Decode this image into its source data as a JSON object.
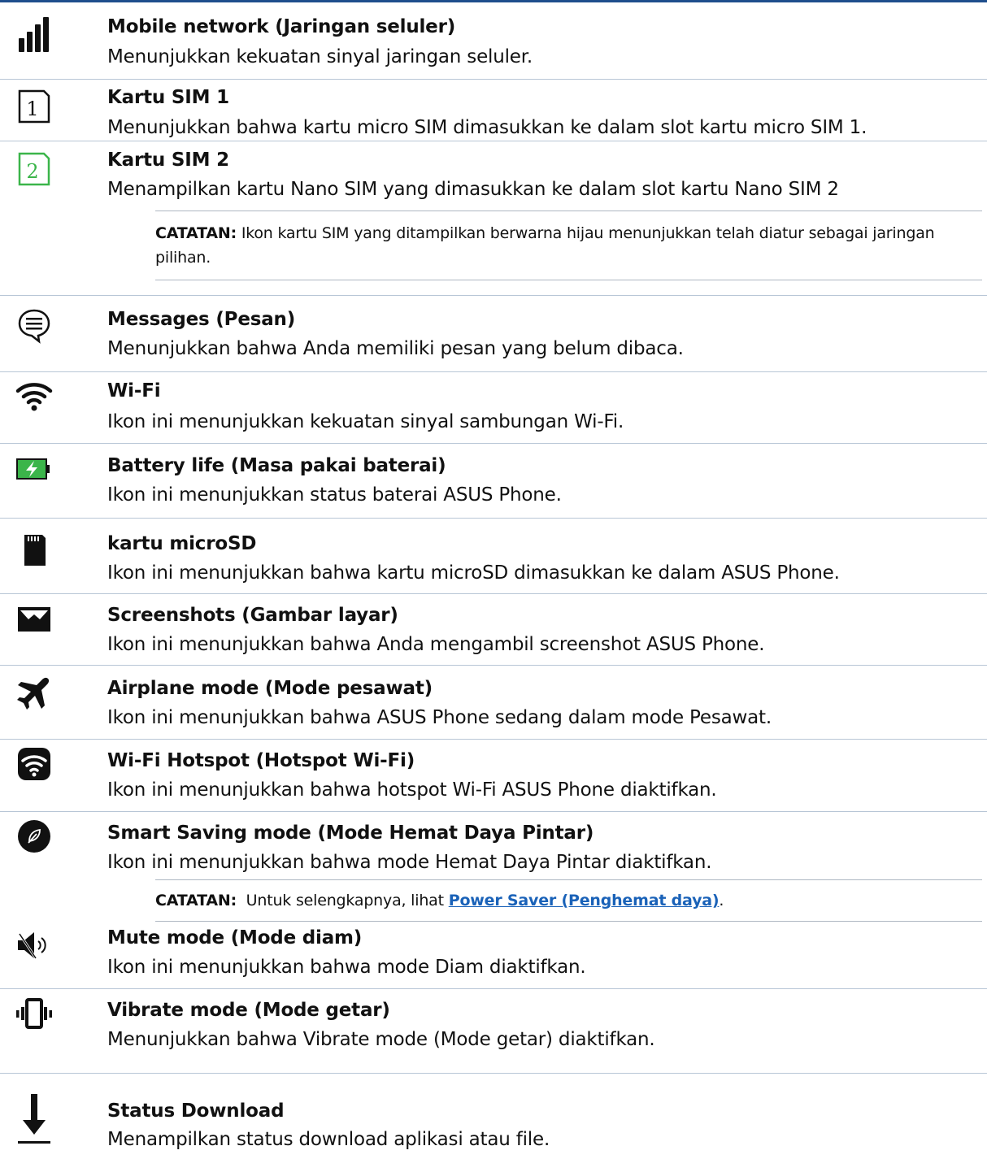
{
  "items": [
    {
      "icon": "signal-strength-icon",
      "title": "Mobile network (Jaringan seluler)",
      "desc": "Menunjukkan kekuatan sinyal jaringan seluler."
    },
    {
      "icon": "sim-card-1-icon",
      "title": "Kartu SIM 1",
      "desc": "Menunjukkan bahwa kartu micro SIM dimasukkan ke dalam slot kartu micro SIM 1."
    },
    {
      "icon": "sim-card-2-icon",
      "title": "Kartu SIM 2",
      "desc": "Menampilkan kartu Nano SIM yang dimasukkan ke dalam slot kartu Nano SIM 2"
    },
    {
      "icon": "message-icon",
      "title": "Messages (Pesan)",
      "desc": "Menunjukkan bahwa Anda memiliki pesan yang belum dibaca."
    },
    {
      "icon": "wifi-icon",
      "title": "Wi-Fi",
      "desc": "Ikon ini menunjukkan kekuatan sinyal sambungan Wi-Fi."
    },
    {
      "icon": "battery-charging-icon",
      "title": "Battery life (Masa pakai baterai)",
      "desc": "Ikon ini menunjukkan status baterai ASUS Phone."
    },
    {
      "icon": "microsd-card-icon",
      "title": "kartu microSD",
      "desc": "Ikon ini menunjukkan bahwa kartu microSD dimasukkan ke dalam ASUS Phone."
    },
    {
      "icon": "screenshot-icon",
      "title": "Screenshots (Gambar layar)",
      "desc": "Ikon ini menunjukkan bahwa Anda mengambil screenshot ASUS Phone."
    },
    {
      "icon": "airplane-icon",
      "title": "Airplane mode (Mode pesawat)",
      "desc": "Ikon ini menunjukkan bahwa ASUS Phone sedang dalam mode Pesawat."
    },
    {
      "icon": "wifi-hotspot-icon",
      "title": "Wi-Fi Hotspot (Hotspot Wi-Fi)",
      "desc": "Ikon ini menunjukkan bahwa hotspot Wi-Fi ASUS Phone diaktifkan."
    },
    {
      "icon": "smart-saving-leaf-icon",
      "title": "Smart Saving mode (Mode Hemat Daya Pintar)",
      "desc": "Ikon ini menunjukkan bahwa mode Hemat Daya Pintar diaktifkan."
    },
    {
      "icon": "mute-speaker-icon",
      "title": "Mute mode (Mode diam)",
      "desc": "Ikon ini menunjukkan bahwa mode Diam diaktifkan."
    },
    {
      "icon": "vibrate-icon",
      "title": "Vibrate mode (Mode getar)",
      "desc": "Menunjukkan bahwa Vibrate mode (Mode getar) diaktifkan."
    },
    {
      "icon": "download-icon",
      "title": "Status Download",
      "desc": "Menampilkan status download aplikasi atau file."
    }
  ],
  "notes": {
    "sim": {
      "label": "CATATAN:",
      "text": " Ikon kartu SIM yang ditampilkan berwarna hijau menunjukkan telah diatur sebagai jaringan pilihan."
    },
    "power": {
      "label": "CATATAN:",
      "text": "  Untuk selengkapnya, lihat ",
      "link": "Power Saver (Penghemat daya)",
      "end": "."
    }
  },
  "colors": {
    "top_rule": "#1f4e8c",
    "link": "#1a62b8",
    "sim2_green": "#3bb54a",
    "battery_green": "#3bb54a"
  }
}
